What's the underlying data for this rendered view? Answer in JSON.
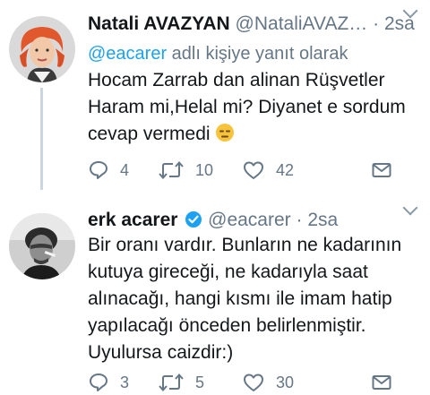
{
  "tweet1": {
    "name": "Natali AVAZYAN",
    "handle": "@NataliAVAZ…",
    "separator": "·",
    "time": "2sa",
    "reply_mention": "@eacarer",
    "reply_suffix": " adlı kişiye yanıt olarak",
    "text_lines": [
      "Hocam Zarrab dan alinan Rüşvetler",
      "Haram mi,Helal mi? Diyanet e sordum",
      "cevap vermedi"
    ],
    "emoji": "expressionless-face-emoji",
    "reply_count": "4",
    "retweet_count": "10",
    "like_count": "42"
  },
  "tweet2": {
    "name": "erk acarer",
    "verified": true,
    "handle": "@eacarer",
    "separator": "·",
    "time": "2sa",
    "text_lines": [
      "Bir oranı vardır. Bunların ne kadarının",
      "kutuya gireceği, ne kadarıyla saat",
      "alınacağı, hangi kısmı ile imam hatip",
      "yapılacağı önceden belirlenmiştir.",
      "Uyulursa caizdir:)"
    ],
    "reply_count": "3",
    "retweet_count": "5",
    "like_count": "30"
  },
  "colors": {
    "text": "#14171a",
    "secondary": "#657786",
    "link": "#1da1f2",
    "icon": "#657786",
    "thread_line": "#ccd6dd",
    "verified": "#1da1f2"
  },
  "icons": [
    "reply-icon",
    "retweet-icon",
    "like-icon",
    "direct-message-icon",
    "chevron-down-icon",
    "verified-badge-icon"
  ]
}
